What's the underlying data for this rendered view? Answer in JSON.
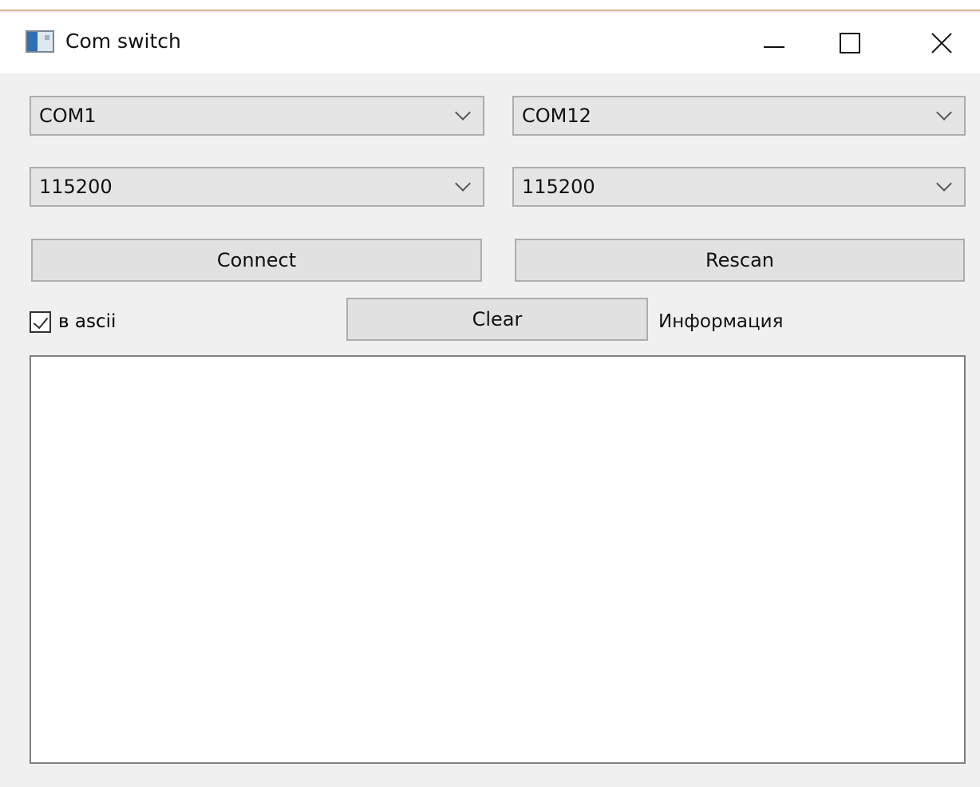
{
  "window": {
    "title": "Com switch",
    "controls": {
      "minimize": "minimize",
      "maximize": "maximize",
      "close": "close"
    }
  },
  "ports": {
    "left_port": "COM1",
    "right_port": "COM12",
    "left_baud": "115200",
    "right_baud": "115200"
  },
  "buttons": {
    "connect": "Connect",
    "rescan": "Rescan",
    "clear": "Clear"
  },
  "options": {
    "ascii_label": "в ascii",
    "ascii_checked": true
  },
  "info": {
    "label": "Информация",
    "text": ""
  },
  "icons": [
    "app-window-icon",
    "minimize-icon",
    "maximize-icon",
    "close-icon",
    "chevron-down-icon",
    "checkbox-check-icon"
  ]
}
